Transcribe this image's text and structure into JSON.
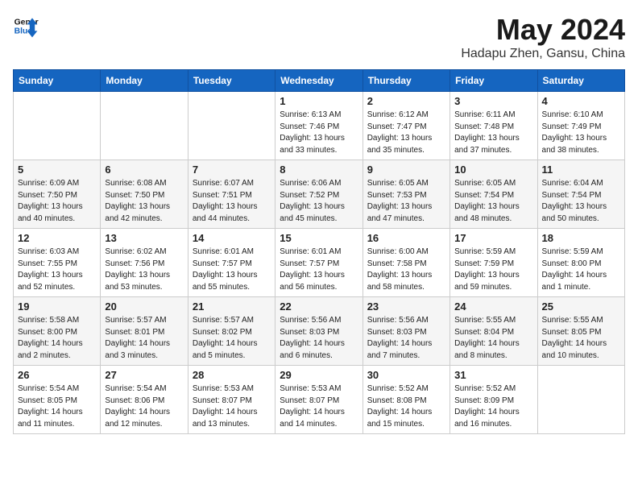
{
  "header": {
    "logo_line1": "General",
    "logo_line2": "Blue",
    "month": "May 2024",
    "location": "Hadapu Zhen, Gansu, China"
  },
  "weekdays": [
    "Sunday",
    "Monday",
    "Tuesday",
    "Wednesday",
    "Thursday",
    "Friday",
    "Saturday"
  ],
  "weeks": [
    [
      {
        "day": "",
        "info": ""
      },
      {
        "day": "",
        "info": ""
      },
      {
        "day": "",
        "info": ""
      },
      {
        "day": "1",
        "info": "Sunrise: 6:13 AM\nSunset: 7:46 PM\nDaylight: 13 hours\nand 33 minutes."
      },
      {
        "day": "2",
        "info": "Sunrise: 6:12 AM\nSunset: 7:47 PM\nDaylight: 13 hours\nand 35 minutes."
      },
      {
        "day": "3",
        "info": "Sunrise: 6:11 AM\nSunset: 7:48 PM\nDaylight: 13 hours\nand 37 minutes."
      },
      {
        "day": "4",
        "info": "Sunrise: 6:10 AM\nSunset: 7:49 PM\nDaylight: 13 hours\nand 38 minutes."
      }
    ],
    [
      {
        "day": "5",
        "info": "Sunrise: 6:09 AM\nSunset: 7:50 PM\nDaylight: 13 hours\nand 40 minutes."
      },
      {
        "day": "6",
        "info": "Sunrise: 6:08 AM\nSunset: 7:50 PM\nDaylight: 13 hours\nand 42 minutes."
      },
      {
        "day": "7",
        "info": "Sunrise: 6:07 AM\nSunset: 7:51 PM\nDaylight: 13 hours\nand 44 minutes."
      },
      {
        "day": "8",
        "info": "Sunrise: 6:06 AM\nSunset: 7:52 PM\nDaylight: 13 hours\nand 45 minutes."
      },
      {
        "day": "9",
        "info": "Sunrise: 6:05 AM\nSunset: 7:53 PM\nDaylight: 13 hours\nand 47 minutes."
      },
      {
        "day": "10",
        "info": "Sunrise: 6:05 AM\nSunset: 7:54 PM\nDaylight: 13 hours\nand 48 minutes."
      },
      {
        "day": "11",
        "info": "Sunrise: 6:04 AM\nSunset: 7:54 PM\nDaylight: 13 hours\nand 50 minutes."
      }
    ],
    [
      {
        "day": "12",
        "info": "Sunrise: 6:03 AM\nSunset: 7:55 PM\nDaylight: 13 hours\nand 52 minutes."
      },
      {
        "day": "13",
        "info": "Sunrise: 6:02 AM\nSunset: 7:56 PM\nDaylight: 13 hours\nand 53 minutes."
      },
      {
        "day": "14",
        "info": "Sunrise: 6:01 AM\nSunset: 7:57 PM\nDaylight: 13 hours\nand 55 minutes."
      },
      {
        "day": "15",
        "info": "Sunrise: 6:01 AM\nSunset: 7:57 PM\nDaylight: 13 hours\nand 56 minutes."
      },
      {
        "day": "16",
        "info": "Sunrise: 6:00 AM\nSunset: 7:58 PM\nDaylight: 13 hours\nand 58 minutes."
      },
      {
        "day": "17",
        "info": "Sunrise: 5:59 AM\nSunset: 7:59 PM\nDaylight: 13 hours\nand 59 minutes."
      },
      {
        "day": "18",
        "info": "Sunrise: 5:59 AM\nSunset: 8:00 PM\nDaylight: 14 hours\nand 1 minute."
      }
    ],
    [
      {
        "day": "19",
        "info": "Sunrise: 5:58 AM\nSunset: 8:00 PM\nDaylight: 14 hours\nand 2 minutes."
      },
      {
        "day": "20",
        "info": "Sunrise: 5:57 AM\nSunset: 8:01 PM\nDaylight: 14 hours\nand 3 minutes."
      },
      {
        "day": "21",
        "info": "Sunrise: 5:57 AM\nSunset: 8:02 PM\nDaylight: 14 hours\nand 5 minutes."
      },
      {
        "day": "22",
        "info": "Sunrise: 5:56 AM\nSunset: 8:03 PM\nDaylight: 14 hours\nand 6 minutes."
      },
      {
        "day": "23",
        "info": "Sunrise: 5:56 AM\nSunset: 8:03 PM\nDaylight: 14 hours\nand 7 minutes."
      },
      {
        "day": "24",
        "info": "Sunrise: 5:55 AM\nSunset: 8:04 PM\nDaylight: 14 hours\nand 8 minutes."
      },
      {
        "day": "25",
        "info": "Sunrise: 5:55 AM\nSunset: 8:05 PM\nDaylight: 14 hours\nand 10 minutes."
      }
    ],
    [
      {
        "day": "26",
        "info": "Sunrise: 5:54 AM\nSunset: 8:05 PM\nDaylight: 14 hours\nand 11 minutes."
      },
      {
        "day": "27",
        "info": "Sunrise: 5:54 AM\nSunset: 8:06 PM\nDaylight: 14 hours\nand 12 minutes."
      },
      {
        "day": "28",
        "info": "Sunrise: 5:53 AM\nSunset: 8:07 PM\nDaylight: 14 hours\nand 13 minutes."
      },
      {
        "day": "29",
        "info": "Sunrise: 5:53 AM\nSunset: 8:07 PM\nDaylight: 14 hours\nand 14 minutes."
      },
      {
        "day": "30",
        "info": "Sunrise: 5:52 AM\nSunset: 8:08 PM\nDaylight: 14 hours\nand 15 minutes."
      },
      {
        "day": "31",
        "info": "Sunrise: 5:52 AM\nSunset: 8:09 PM\nDaylight: 14 hours\nand 16 minutes."
      },
      {
        "day": "",
        "info": ""
      }
    ]
  ]
}
